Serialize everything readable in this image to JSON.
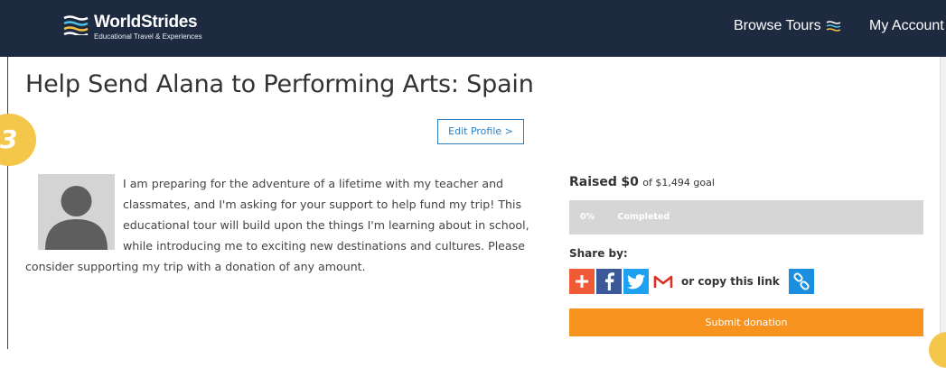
{
  "header": {
    "logo_name": "WorldStrides",
    "logo_tagline": "Educational Travel & Experiences",
    "nav_browse": "Browse Tours",
    "nav_account": "My Account"
  },
  "badge_number": "3",
  "page": {
    "title": "Help Send Alana to Performing Arts: Spain",
    "edit_profile": "Edit Profile >",
    "description": "I am preparing for the adventure of a lifetime with my teacher and classmates, and I'm asking for your support to help fund my trip! This educational tour will build upon the things I'm learning about in school, while introducing me to exciting new destinations and cultures. Please consider supporting my trip with a donation of any amount."
  },
  "fundraising": {
    "raised_label": "Raised",
    "raised_amount": "$0",
    "goal_text": "of $1,494 goal",
    "progress_percent": "0%",
    "progress_status": "Completed",
    "progress_fraction": 0,
    "share_label": "Share by:",
    "copy_link_text": "or copy this link",
    "submit_label": "Submit donation"
  },
  "icons": [
    "menu-lines-icon",
    "plus-icon",
    "facebook-icon",
    "twitter-icon",
    "gmail-icon",
    "link-icon"
  ],
  "colors": {
    "header_bg": "#1e2a3f",
    "accent_orange": "#f7931e",
    "link_blue": "#2b7fc1",
    "badge_yellow": "#f4c64a"
  }
}
